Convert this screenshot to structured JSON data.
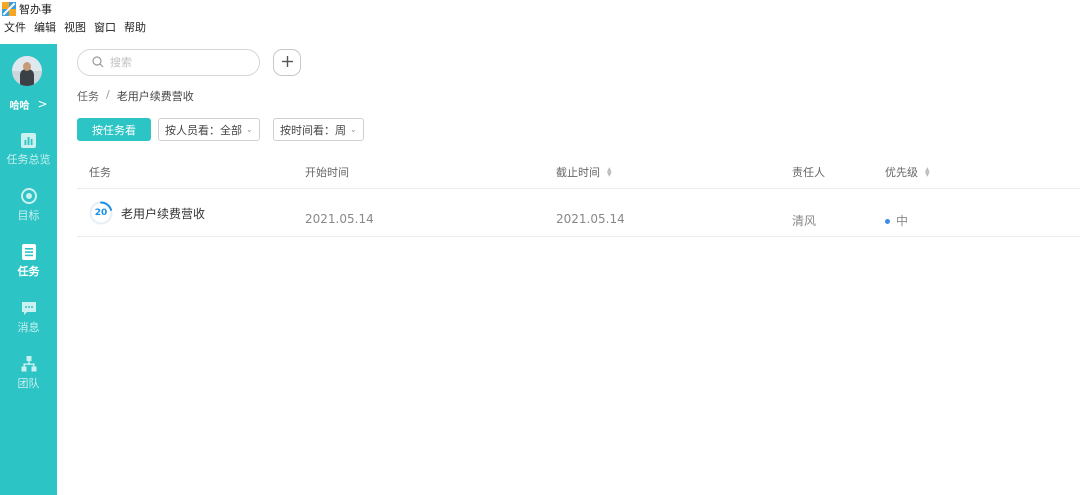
{
  "app": {
    "title": "智办事"
  },
  "menu": [
    "文件",
    "编辑",
    "视图",
    "窗口",
    "帮助"
  ],
  "user": {
    "name": "哈哈"
  },
  "sidebar": {
    "items": [
      {
        "label": "任务总览",
        "icon": "chart-icon",
        "active": false
      },
      {
        "label": "目标",
        "icon": "target-icon",
        "active": false
      },
      {
        "label": "任务",
        "icon": "task-list-icon",
        "active": true
      },
      {
        "label": "消息",
        "icon": "message-icon",
        "active": false
      },
      {
        "label": "团队",
        "icon": "team-icon",
        "active": false
      }
    ]
  },
  "search": {
    "placeholder": "搜索"
  },
  "breadcrumb": {
    "root": "任务",
    "separator": "/",
    "current": "老用户续费营收"
  },
  "toolbar": {
    "view_button": "按任务看",
    "filter_person": "按人员看：全部",
    "filter_time": "按时间看：周"
  },
  "table": {
    "headers": {
      "task": "任务",
      "start": "开始时间",
      "deadline": "截止时间",
      "owner": "责任人",
      "priority": "优先级"
    },
    "rows": [
      {
        "progress": "20",
        "progress_fraction": 0.2,
        "name": "老用户续费营收",
        "start": "2021.05.14",
        "deadline": "2021.05.14",
        "owner": "清风",
        "priority": "中"
      }
    ]
  },
  "colors": {
    "accent": "#2cc4c4",
    "progress": "#1a8fe8",
    "priority_dot": "#3a8ee6"
  }
}
